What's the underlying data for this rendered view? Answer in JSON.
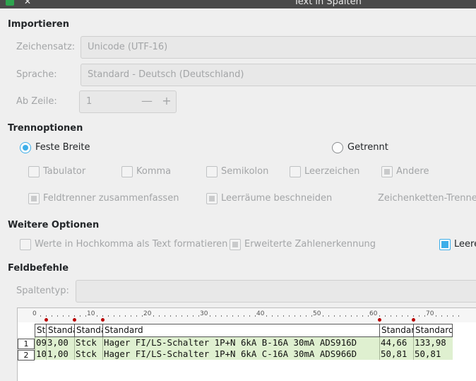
{
  "window": {
    "title": "Text in Spalten"
  },
  "import": {
    "heading": "Importieren",
    "charset_label": "Zeichensatz:",
    "charset_value": "Unicode (UTF-16)",
    "language_label": "Sprache:",
    "language_value": "Standard - Deutsch (Deutschland)",
    "from_row_label": "Ab Zeile:",
    "from_row_value": "1",
    "minus": "—",
    "plus": "+"
  },
  "separator": {
    "heading": "Trennoptionen",
    "fixed_width": "Feste Breite",
    "separated": "Getrennt",
    "tab": "Tabulator",
    "comma": "Komma",
    "semicolon": "Semikolon",
    "space": "Leerzeichen",
    "other": "Andere",
    "merge": "Feldtrenner zusammenfassen",
    "trim": "Leerräume beschneiden",
    "string_delim": "Zeichenketten-Trenner"
  },
  "more": {
    "heading": "Weitere Optionen",
    "quoted": "Werte in Hochkomma als Text formatieren",
    "numbers": "Erweiterte Zahlenerkennung",
    "empty": "Leere"
  },
  "fields": {
    "heading": "Feldbefehle",
    "col_type_label": "Spaltentyp:"
  },
  "preview": {
    "ruler": [
      "0",
      "10",
      "20",
      "30",
      "40",
      "50",
      "60",
      "70"
    ],
    "headers": [
      "St",
      "Standa",
      "Standa",
      "Standard",
      "Standar",
      "Standard"
    ],
    "rows": [
      {
        "num": "1",
        "cells": [
          "09",
          "3,00",
          "Stck",
          "Hager FI/LS-Schalter 1P+N 6kA B-16A 30mA ADS916D",
          "44,66",
          "133,98"
        ]
      },
      {
        "num": "2",
        "cells": [
          "10",
          "1,00",
          "Stck",
          "Hager FI/LS-Schalter 1P+N 6kA C-16A 30mA ADS966D",
          "50,81",
          "50,81"
        ]
      }
    ]
  },
  "colors": {
    "accent": "#3daee9",
    "cell_bg": "#dff0d0",
    "window_bg": "#efefef"
  }
}
